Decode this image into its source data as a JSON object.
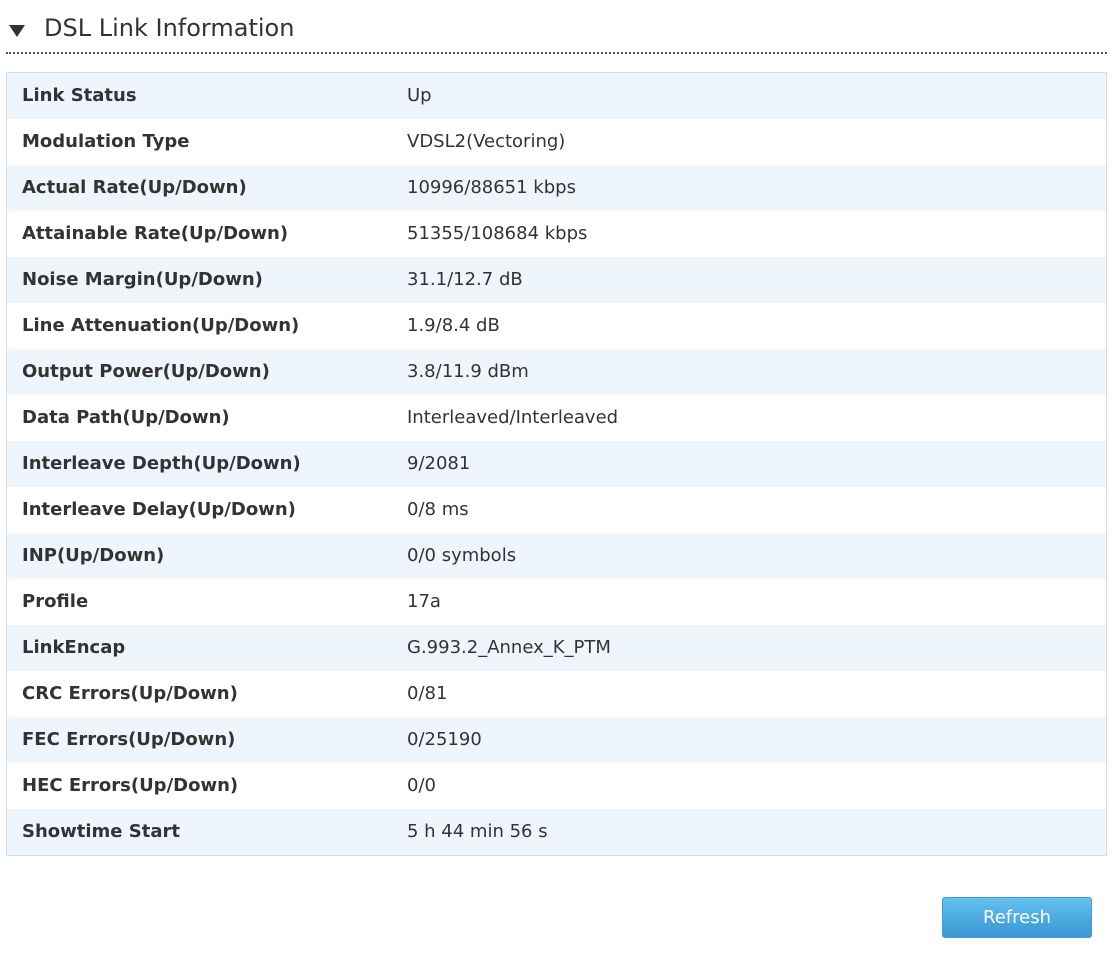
{
  "section": {
    "title": "DSL Link Information",
    "toggle_icon": "triangle-down-icon"
  },
  "rows": [
    {
      "label": "Link Status",
      "value": "Up"
    },
    {
      "label": "Modulation Type",
      "value": "VDSL2(Vectoring)"
    },
    {
      "label": "Actual Rate(Up/Down)",
      "value": "10996/88651 kbps"
    },
    {
      "label": "Attainable Rate(Up/Down)",
      "value": "51355/108684 kbps"
    },
    {
      "label": "Noise Margin(Up/Down)",
      "value": "31.1/12.7 dB"
    },
    {
      "label": "Line Attenuation(Up/Down)",
      "value": "1.9/8.4 dB"
    },
    {
      "label": "Output Power(Up/Down)",
      "value": "3.8/11.9 dBm"
    },
    {
      "label": "Data Path(Up/Down)",
      "value": "Interleaved/Interleaved"
    },
    {
      "label": "Interleave Depth(Up/Down)",
      "value": "9/2081"
    },
    {
      "label": "Interleave Delay(Up/Down)",
      "value": "0/8 ms"
    },
    {
      "label": "INP(Up/Down)",
      "value": "0/0 symbols"
    },
    {
      "label": "Profile",
      "value": "17a"
    },
    {
      "label": "LinkEncap",
      "value": "G.993.2_Annex_K_PTM"
    },
    {
      "label": "CRC Errors(Up/Down)",
      "value": "0/81"
    },
    {
      "label": "FEC Errors(Up/Down)",
      "value": "0/25190"
    },
    {
      "label": "HEC Errors(Up/Down)",
      "value": "0/0"
    },
    {
      "label": "Showtime Start",
      "value": "5 h 44 min 56 s"
    }
  ],
  "actions": {
    "refresh_label": "Refresh"
  },
  "colors": {
    "row_stripe": "#eef5fc",
    "row_plain": "#ffffff",
    "button_accent": "#4aa9df"
  }
}
